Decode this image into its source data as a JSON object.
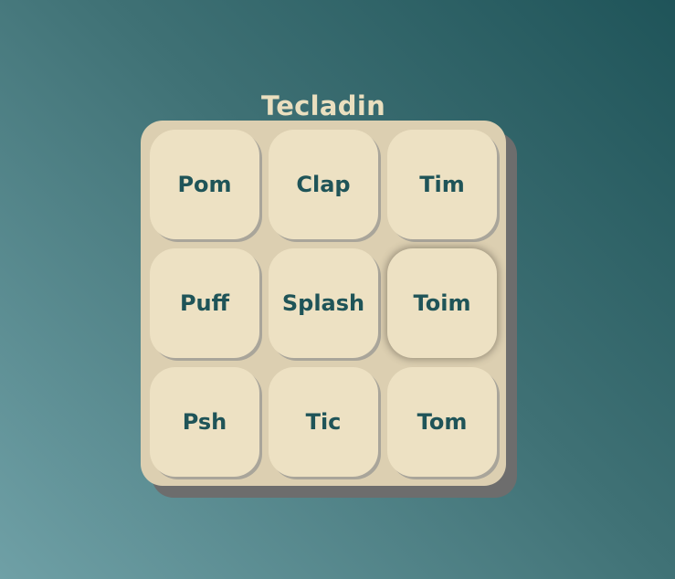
{
  "app": {
    "title": "Tecladin"
  },
  "keypad": {
    "keys": [
      {
        "label": "Pom"
      },
      {
        "label": "Clap"
      },
      {
        "label": "Tim"
      },
      {
        "label": "Puff"
      },
      {
        "label": "Splash"
      },
      {
        "label": "Toim"
      },
      {
        "label": "Psh"
      },
      {
        "label": "Tic"
      },
      {
        "label": "Tom"
      }
    ],
    "active_key": "Toim"
  },
  "colors": {
    "background_dark": "#1f5459",
    "background_light": "#6fa0a6",
    "title_text": "#eadfbf",
    "keyboard_base": "#dccfb1",
    "keyboard_shadow": "#6d6d6d",
    "key_face": "#ede1c3",
    "key_text": "#1f5458"
  }
}
